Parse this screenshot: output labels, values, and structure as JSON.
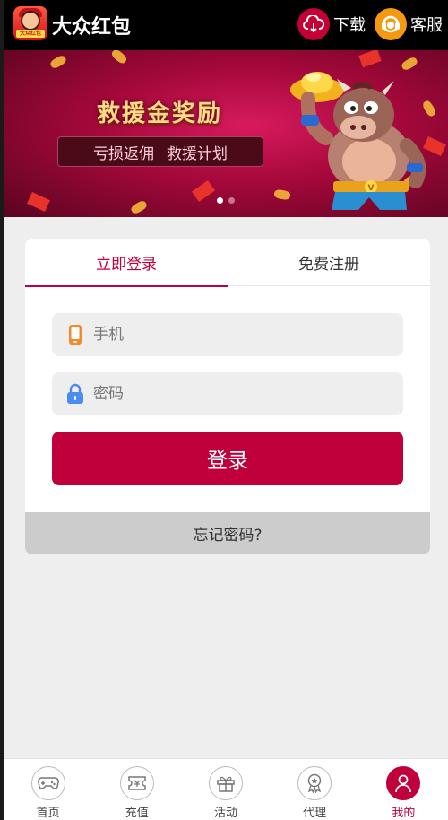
{
  "header": {
    "app_title": "大众红包",
    "logo_tag": "大众红包",
    "download_label": "下载",
    "service_label": "客服"
  },
  "banner": {
    "title": "救援金奖励",
    "sub_left": "亏损返佣",
    "sub_right": "救援计划",
    "bull_letter": "V",
    "slide_count": 2,
    "active_slide": 1
  },
  "login_card": {
    "tabs": [
      {
        "label": "立即登录",
        "active": true
      },
      {
        "label": "免费注册",
        "active": false
      }
    ],
    "phone_placeholder": "手机",
    "password_placeholder": "密码",
    "login_button": "登录",
    "forgot_link": "忘记密码?"
  },
  "bottom_nav": {
    "items": [
      {
        "label": "首页",
        "icon": "gamepad-icon",
        "active": false
      },
      {
        "label": "充值",
        "icon": "ticket-icon",
        "active": false
      },
      {
        "label": "活动",
        "icon": "gift-icon",
        "active": false
      },
      {
        "label": "代理",
        "icon": "award-icon",
        "active": false
      },
      {
        "label": "我的",
        "icon": "user-icon",
        "active": true
      }
    ]
  },
  "colors": {
    "brand": "#c0003a",
    "header_bg": "#000000",
    "download_circle": "#c40034",
    "service_circle": "#f39a12",
    "phone_icon": "#f08a2a",
    "lock_icon": "#4a8df0"
  }
}
